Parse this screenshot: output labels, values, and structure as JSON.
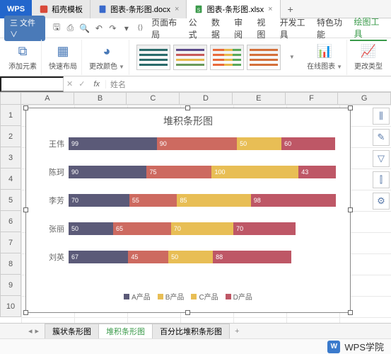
{
  "tabs": {
    "logo": "WPS",
    "items": [
      {
        "icon": "template",
        "label": "稻壳模板"
      },
      {
        "icon": "doc",
        "label": "图表-条形图.docx"
      },
      {
        "icon": "xls",
        "label": "图表-条形图.xlsx",
        "active": true
      }
    ],
    "add": "+"
  },
  "menubar": {
    "file": "三 文件 ∨",
    "items": [
      "页面布局",
      "公式",
      "数据",
      "审阅",
      "视图",
      "开发工具",
      "特色功能"
    ],
    "active": "绘图工具"
  },
  "ribbon": {
    "add_element": "添加元素",
    "quick_layout": "快速布局",
    "change_color": "更改颜色",
    "online_chart": "在线图表",
    "change_type": "更改类型"
  },
  "formula": {
    "namebox": "",
    "fx": "fx",
    "value": "姓名"
  },
  "columns": [
    "A",
    "B",
    "C",
    "D",
    "E",
    "F",
    "G"
  ],
  "rows": [
    "1",
    "2",
    "3",
    "4",
    "5",
    "6",
    "7",
    "8",
    "9",
    "10"
  ],
  "chart_data": {
    "type": "bar",
    "title": "堆积条形图",
    "categories": [
      "王伟",
      "陈珂",
      "李芳",
      "张丽",
      "刘英"
    ],
    "series": [
      {
        "name": "A产品",
        "values": [
          99,
          90,
          70,
          50,
          67
        ],
        "color": "#5b5a78"
      },
      {
        "name": "B产品",
        "values": [
          90,
          75,
          55,
          65,
          45
        ],
        "color": "#cd6a60"
      },
      {
        "name": "C产品",
        "values": [
          50,
          100,
          85,
          70,
          50
        ],
        "color": "#e8be55"
      },
      {
        "name": "D产品",
        "values": [
          60,
          43,
          98,
          70,
          88
        ],
        "color": "#be5766"
      }
    ],
    "xlabel": "",
    "ylabel": "",
    "xlim": [
      0,
      300
    ]
  },
  "side_tools": [
    "chart-element-icon",
    "brush-icon",
    "filter-icon",
    "chart-type-icon",
    "settings-icon"
  ],
  "sheet_tabs": {
    "items": [
      "簇状条形图",
      "堆积条形图",
      "百分比堆积条形图"
    ],
    "active": 1,
    "add": "+"
  },
  "footer": {
    "brand": "WPS学院"
  }
}
